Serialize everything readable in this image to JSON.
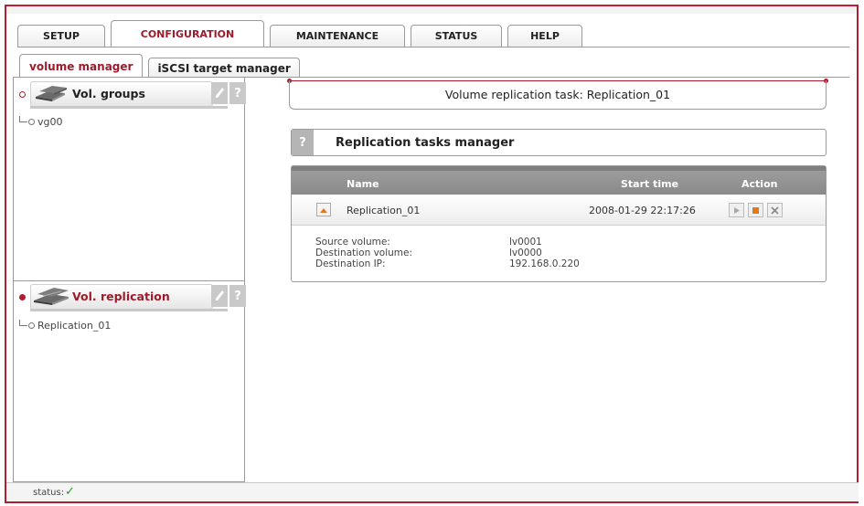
{
  "main_tabs": [
    "SETUP",
    "CONFIGURATION",
    "MAINTENANCE",
    "STATUS",
    "HELP"
  ],
  "active_main_tab": "CONFIGURATION",
  "sub_tabs": [
    "volume manager",
    "iSCSI target manager"
  ],
  "active_sub_tab": "volume manager",
  "left_panel": {
    "vol_groups": {
      "title": "Vol. groups",
      "icon": "hard-disks-icon",
      "tool_icon": "wrench-icon",
      "help_label": "?",
      "items": [
        "vg00"
      ]
    },
    "vol_replication": {
      "title": "Vol. replication",
      "icon": "replication-disks-icon",
      "tool_icon": "wrench-icon",
      "help_label": "?",
      "items": [
        "Replication_01"
      ]
    }
  },
  "main": {
    "title": "Volume replication task: Replication_01",
    "section": {
      "help_label": "?",
      "title": "Replication tasks manager"
    },
    "table": {
      "columns": [
        "Name",
        "Start time",
        "Action"
      ],
      "rows": [
        {
          "name": "Replication_01",
          "start_time": "2008-01-29 22:17:26",
          "actions": [
            "play-icon",
            "stop-icon",
            "delete-icon"
          ]
        }
      ],
      "details": {
        "source_label": "Source volume:",
        "source_value": "lv0001",
        "dest_label": "Destination volume:",
        "dest_value": "lv0000",
        "ip_label": "Destination IP:",
        "ip_value": "192.168.0.220"
      }
    }
  },
  "status": {
    "label": "status:",
    "icon": "check-icon",
    "check_color": "#2d9a1f"
  },
  "colors": {
    "accent": "#9e1a2b",
    "frame": "#b11d30"
  }
}
